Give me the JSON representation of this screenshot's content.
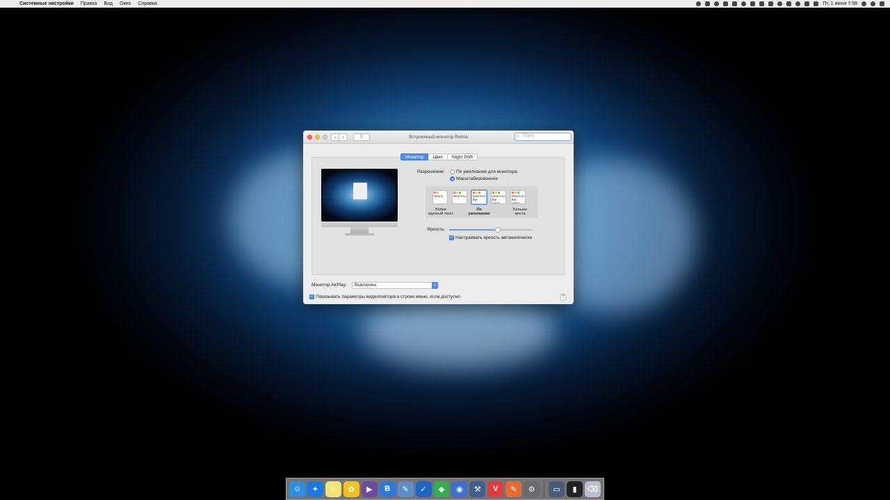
{
  "menubar": {
    "app_name": "Системные настройки",
    "items": [
      "Правка",
      "Вид",
      "Окно",
      "Справка"
    ],
    "clock": "Пт, 1 июня  7:58"
  },
  "window": {
    "title": "Встроенный монитор Retina",
    "search_placeholder": "Поиск",
    "tabs": [
      {
        "label": "Монитор",
        "active": true
      },
      {
        "label": "Цвет",
        "active": false
      },
      {
        "label": "Night Shift",
        "active": false
      }
    ],
    "resolution": {
      "label": "Разрешение:",
      "options": [
        {
          "label": "По умолчанию для монитора",
          "selected": false
        },
        {
          "label": "Масштабированное",
          "selected": true
        }
      ]
    },
    "scales": {
      "sample_text": [
        "Here's",
        "Here's to",
        "Here's to the",
        "Here's to the crazy",
        "Here's to the crazy ones"
      ],
      "captions": {
        "larger_1": "Более",
        "larger_2": "крупный текст",
        "default_1": "По",
        "default_2": "умолчанию",
        "more_1": "Больше",
        "more_2": "места"
      },
      "selected_index": 2
    },
    "brightness": {
      "label": "Яркость:",
      "level": 0.58,
      "auto_label": "Настраивать яркость автоматически",
      "auto_checked": true
    },
    "airplay": {
      "label": "Монитор AirPlay:",
      "value": "Выключен"
    },
    "mirroring": {
      "label": "Показывать параметры видеоповтора в строке меню, если доступно",
      "checked": true
    },
    "help": "?"
  },
  "dock": {
    "apps": [
      {
        "name": "Finder",
        "glyph": "☺",
        "color": "#2b8fe6"
      },
      {
        "name": "Safari",
        "glyph": "✦",
        "color": "#1a7ae0"
      },
      {
        "name": "Notes",
        "glyph": "≡",
        "color": "#f1e27a"
      },
      {
        "name": "Tes",
        "glyph": "✿",
        "color": "#f3c21c"
      },
      {
        "name": "Final Cut Pro",
        "glyph": "▶",
        "color": "#6a4c9c"
      },
      {
        "name": "VK",
        "glyph": "В",
        "color": "#2d7bd8"
      },
      {
        "name": "Preview",
        "glyph": "✎",
        "color": "#5e8dc7"
      },
      {
        "name": "Tasks",
        "glyph": "✓",
        "color": "#1f64c8"
      },
      {
        "name": "Evernote",
        "glyph": "◆",
        "color": "#2fb24c"
      },
      {
        "name": "Chrome",
        "glyph": "◉",
        "color": "#3b6fd6"
      },
      {
        "name": "Xcode",
        "glyph": "⚒",
        "color": "#3e5f8f"
      },
      {
        "name": "Vivaldi",
        "glyph": "V",
        "color": "#e23b3b"
      },
      {
        "name": "Sketch",
        "glyph": "✎",
        "color": "#e86a2f"
      },
      {
        "name": "System Preferences",
        "glyph": "⚙",
        "color": "#6b6b6b"
      }
    ],
    "extras": [
      {
        "name": "Downloads",
        "glyph": "▭",
        "color": "#4a5b77"
      },
      {
        "name": "Terminal",
        "glyph": "▮",
        "color": "#222222"
      },
      {
        "name": "Trash",
        "glyph": "⌫",
        "color": "#b9c2cc"
      }
    ]
  }
}
